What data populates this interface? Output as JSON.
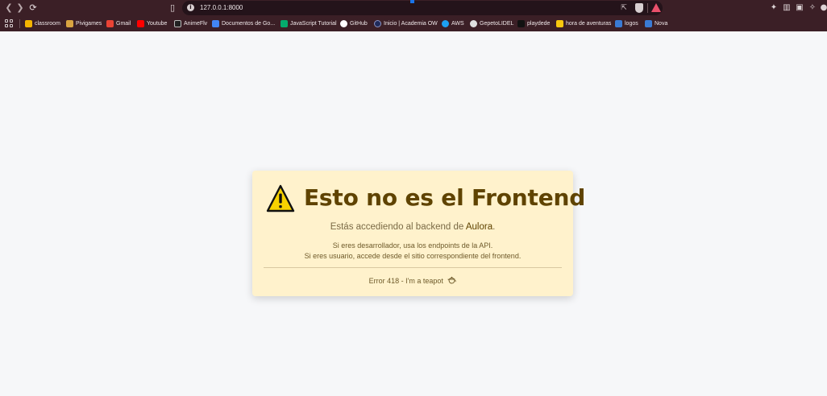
{
  "browser": {
    "url": "127.0.0.1:8000",
    "bookmarks": [
      {
        "label": "classroom",
        "color": "#f4b400"
      },
      {
        "label": "Pivigames",
        "color": "#d9a441"
      },
      {
        "label": "Gmail",
        "color": "#ea4335"
      },
      {
        "label": "Youtube",
        "color": "#ff0000"
      },
      {
        "label": "AnimeFlv",
        "color": "#222222"
      },
      {
        "label": "Documentos de Go...",
        "color": "#4285f4"
      },
      {
        "label": "JavaScript Tutorial",
        "color": "#04aa6d"
      },
      {
        "label": "GitHub",
        "color": "#ffffff"
      },
      {
        "label": "Inicio | Academia OW",
        "color": "#1f2b5b"
      },
      {
        "label": "AWS",
        "color": "#1da1f2"
      },
      {
        "label": "GepetoLIDEL",
        "color": "#e0e0e0"
      },
      {
        "label": "playdede",
        "color": "#111111"
      },
      {
        "label": "hora de aventuras",
        "color": "#f9c80e"
      },
      {
        "label": "logos",
        "color": "#3a7bd5"
      },
      {
        "label": "Nova",
        "color": "#3a7bd5"
      }
    ]
  },
  "notice": {
    "title": "Esto no es el Frontend",
    "subtitle_prefix": "Estás accediendo al backend de ",
    "subtitle_brand": "Aulora",
    "subtitle_suffix": ".",
    "line1": "Si eres desarrollador, usa los endpoints de la API.",
    "line2": "Si eres usuario, accede desde el sitio correspondiente del frontend.",
    "footer": "Error 418 - I'm a teapot",
    "icon": "warning-icon",
    "footer_icon": "teapot-icon",
    "colors": {
      "card_bg": "#fff2cc",
      "title": "#5f4300",
      "warning_fill": "#f7d200"
    }
  }
}
